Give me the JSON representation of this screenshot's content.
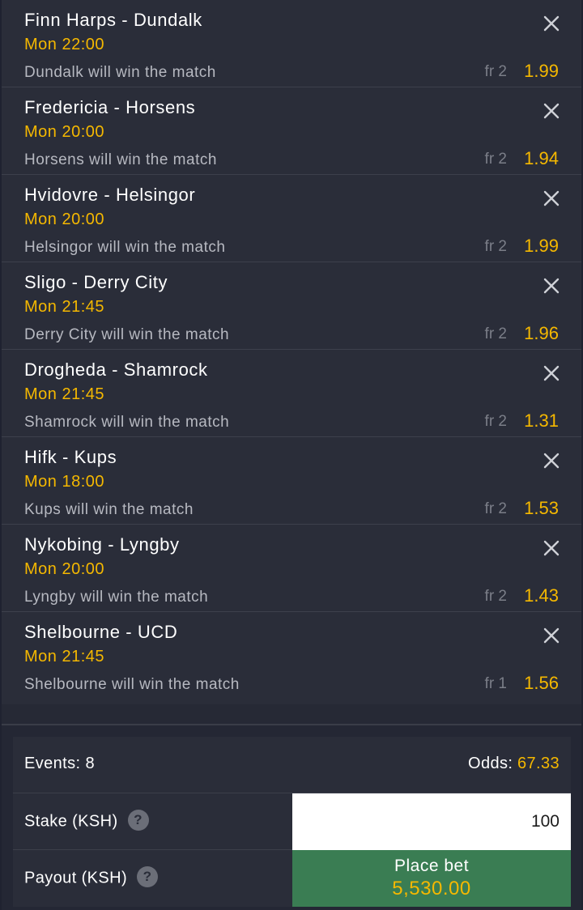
{
  "bets": [
    {
      "match": "Finn Harps - Dundalk",
      "time": "Mon 22:00",
      "pick": "Dundalk will win the match",
      "market": "fr 2",
      "odds": "1.99"
    },
    {
      "match": "Fredericia - Horsens",
      "time": "Mon 20:00",
      "pick": "Horsens will win the match",
      "market": "fr 2",
      "odds": "1.94"
    },
    {
      "match": "Hvidovre - Helsingor",
      "time": "Mon 20:00",
      "pick": "Helsingor will win the match",
      "market": "fr 2",
      "odds": "1.99"
    },
    {
      "match": "Sligo - Derry City",
      "time": "Mon 21:45",
      "pick": "Derry City will win the match",
      "market": "fr 2",
      "odds": "1.96"
    },
    {
      "match": "Drogheda - Shamrock",
      "time": "Mon 21:45",
      "pick": "Shamrock will win the match",
      "market": "fr 2",
      "odds": "1.31"
    },
    {
      "match": "Hifk - Kups",
      "time": "Mon 18:00",
      "pick": "Kups will win the match",
      "market": "fr 2",
      "odds": "1.53"
    },
    {
      "match": "Nykobing - Lyngby",
      "time": "Mon 20:00",
      "pick": "Lyngby will win the match",
      "market": "fr 2",
      "odds": "1.43"
    },
    {
      "match": "Shelbourne - UCD",
      "time": "Mon 21:45",
      "pick": "Shelbourne will win the match",
      "market": "fr 1",
      "odds": "1.56"
    }
  ],
  "summary": {
    "events_label": "Events: 8",
    "odds_label": "Odds:",
    "odds_total": "67.33",
    "stake_label": "Stake (KSH)",
    "stake_value": "100",
    "payout_label": "Payout (KSH)",
    "help_glyph": "?",
    "place_bet_label": "Place bet",
    "payout_amount": "5,530.00"
  },
  "icons": {
    "remove": "close-icon",
    "help": "help-icon"
  },
  "colors": {
    "background": "#2a2d39",
    "accent": "#f5b800",
    "place_bet": "#3a7d53",
    "muted_text": "#b7b9c1"
  }
}
